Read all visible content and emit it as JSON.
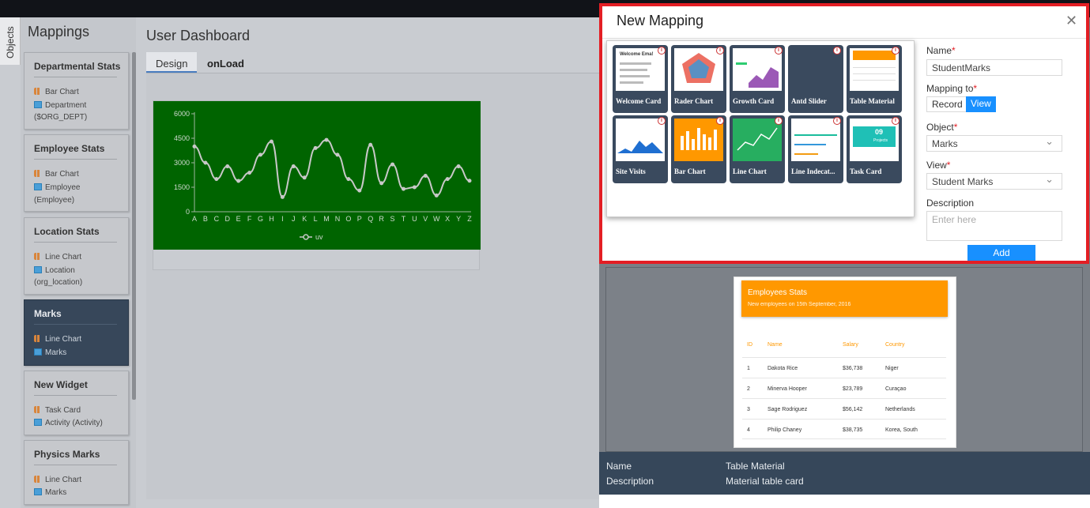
{
  "objects_tab": "Objects",
  "mappings": {
    "title": "Mappings",
    "cards": [
      {
        "title": "Departmental Stats",
        "chart": "Bar Chart",
        "object": "Department",
        "object2": "($ORG_DEPT)"
      },
      {
        "title": "Employee Stats",
        "chart": "Bar Chart",
        "object": "Employee",
        "object2": "(Employee)"
      },
      {
        "title": "Location Stats",
        "chart": "Line Chart",
        "object": "Location",
        "object2": "(org_location)"
      },
      {
        "title": "Marks",
        "chart": "Line Chart",
        "object": "Marks",
        "object2": ""
      },
      {
        "title": "New Widget",
        "chart": "Task Card",
        "object": "Activity (Activity)",
        "object2": ""
      },
      {
        "title": "Physics Marks",
        "chart": "Line Chart",
        "object": "Marks",
        "object2": ""
      }
    ]
  },
  "dashboard": {
    "title": "User Dashboard",
    "tabs": [
      "Design",
      "onLoad"
    ]
  },
  "chart_data": {
    "type": "line",
    "categories": [
      "A",
      "B",
      "C",
      "D",
      "E",
      "F",
      "G",
      "H",
      "I",
      "J",
      "K",
      "L",
      "M",
      "N",
      "O",
      "P",
      "Q",
      "R",
      "S",
      "T",
      "U",
      "V",
      "W",
      "X",
      "Y",
      "Z"
    ],
    "series": [
      {
        "name": "uv",
        "values": [
          4000,
          3000,
          2000,
          2780,
          1890,
          2390,
          3490,
          4300,
          900,
          2780,
          2090,
          3900,
          4400,
          3490,
          2000,
          1300,
          4100,
          1750,
          2900,
          1400,
          1500,
          2200,
          1000,
          2000,
          2780,
          1900
        ]
      }
    ],
    "yticks": [
      0,
      1500,
      3000,
      4500,
      6000
    ],
    "ylim": [
      0,
      6000
    ],
    "legend": "bottom-center",
    "colors": {
      "background": "#006400",
      "line": "#c8c8c8"
    }
  },
  "modal": {
    "title": "New Mapping",
    "close": "X",
    "gallery": [
      {
        "label": "Welcome Card",
        "icon": "welcome-card-thumb"
      },
      {
        "label": "Rader Chart",
        "icon": "radar-chart-thumb"
      },
      {
        "label": "Growth Card",
        "icon": "growth-card-thumb"
      },
      {
        "label": "Antd Slider",
        "icon": "slider-thumb"
      },
      {
        "label": "Table Material",
        "icon": "table-material-thumb"
      },
      {
        "label": "Site Visits",
        "icon": "site-visits-thumb"
      },
      {
        "label": "Bar Chart",
        "icon": "bar-chart-thumb"
      },
      {
        "label": "Line Chart",
        "icon": "line-chart-thumb"
      },
      {
        "label": "Line Indecat...",
        "icon": "line-indicator-thumb"
      },
      {
        "label": "Task Card",
        "icon": "task-card-thumb"
      }
    ],
    "info_glyph": "i",
    "thumb_texts": {
      "welcome": "Welcome Ema!",
      "task_num": "09",
      "task_label": "Projects"
    },
    "form": {
      "name_label": "Name",
      "name_value": "StudentMarks",
      "mapping_label": "Mapping to",
      "mapping_options": [
        "Record",
        "View"
      ],
      "mapping_selected": "View",
      "object_label": "Object",
      "object_value": "Marks",
      "view_label": "View",
      "view_value": "Student Marks",
      "description_label": "Description",
      "description_placeholder": "Enter here",
      "required_mark": "*",
      "add_label": "Add"
    }
  },
  "preview": {
    "header_title": "Employees Stats",
    "header_sub": "New employees on 15th September, 2016",
    "columns": [
      "ID",
      "Name",
      "Salary",
      "Country"
    ],
    "rows": [
      [
        "1",
        "Dakota Rice",
        "$36,738",
        "Niger"
      ],
      [
        "2",
        "Minerva Hooper",
        "$23,789",
        "Curaçao"
      ],
      [
        "3",
        "Sage Rodriguez",
        "$56,142",
        "Netherlands"
      ],
      [
        "4",
        "Philip Chaney",
        "$38,735",
        "Korea, South"
      ]
    ],
    "name_label": "Name",
    "name_value": "Table Material",
    "description_label": "Description",
    "description_value": "Material table card"
  }
}
